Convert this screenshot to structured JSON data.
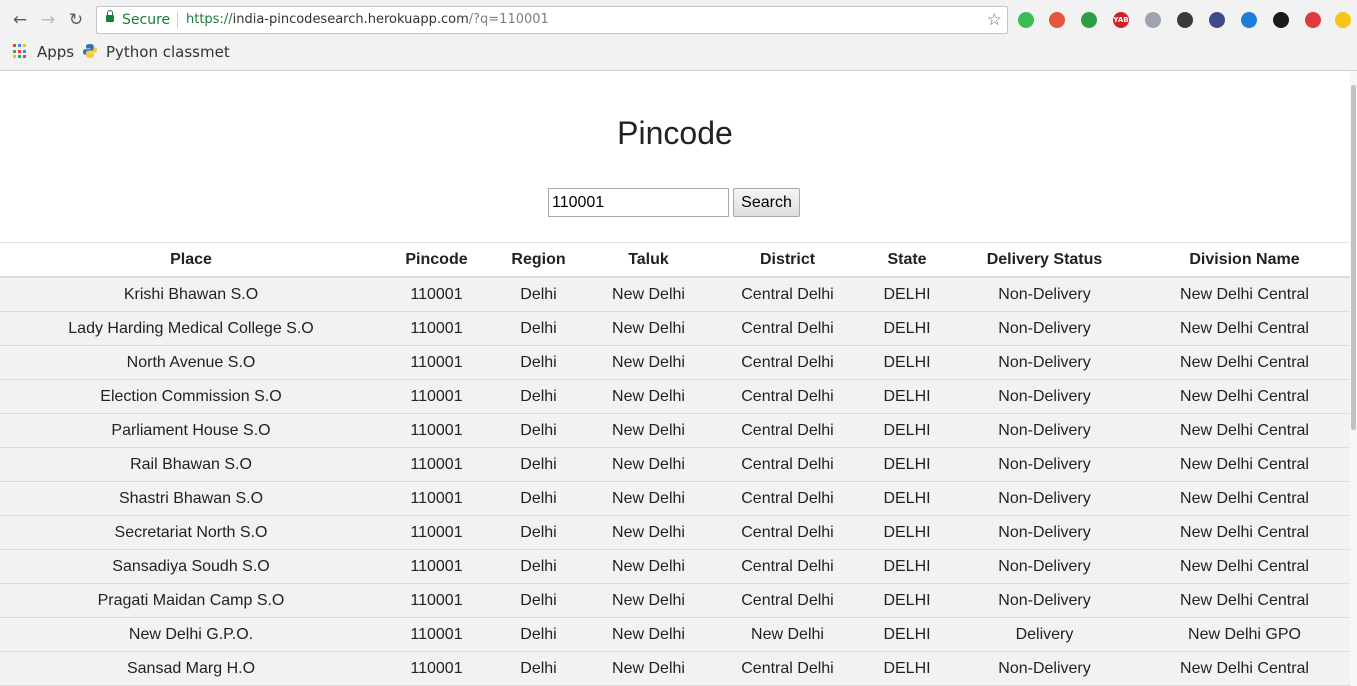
{
  "browser": {
    "secure_label": "Secure",
    "url_scheme": "https://",
    "url_host": "india-pincodesearch.herokuapp.com",
    "url_rest": "/?q=110001",
    "bookmarks": {
      "apps_label": "Apps",
      "python_label": "Python classmet"
    },
    "extensions": [
      {
        "name": "green-extension-icon",
        "color": "#3cba54"
      },
      {
        "name": "blocked-site-extension-icon",
        "color": "#e2553f"
      },
      {
        "name": "green-shield-extension-icon",
        "color": "#2e9e45"
      },
      {
        "name": "yab-extension-icon",
        "color": "#d62027",
        "label": "YAB"
      },
      {
        "name": "gray-circle-extension-icon",
        "color": "#9ea3b0"
      },
      {
        "name": "dark-square-extension-icon",
        "color": "#3a3a3a"
      },
      {
        "name": "at-sign-extension-icon",
        "color": "#3d4b8a"
      },
      {
        "name": "blue-badge-extension-icon",
        "color": "#1e7dd6"
      },
      {
        "name": "github-extension-icon",
        "color": "#1b1b1b"
      },
      {
        "name": "red-tag-extension-icon",
        "color": "#e23a3a"
      },
      {
        "name": "yellow-alert-extension-icon",
        "color": "#f5c518"
      }
    ]
  },
  "page": {
    "title": "Pincode",
    "search": {
      "value": "110001",
      "button_label": "Search"
    }
  },
  "table": {
    "headers": {
      "place": "Place",
      "pincode": "Pincode",
      "region": "Region",
      "taluk": "Taluk",
      "district": "District",
      "state": "State",
      "delivery_status": "Delivery Status",
      "division_name": "Division Name"
    },
    "rows": [
      {
        "place": "Krishi Bhawan S.O",
        "pincode": "110001",
        "region": "Delhi",
        "taluk": "New Delhi",
        "district": "Central Delhi",
        "state": "DELHI",
        "delivery_status": "Non-Delivery",
        "division_name": "New Delhi Central"
      },
      {
        "place": "Lady Harding Medical College S.O",
        "pincode": "110001",
        "region": "Delhi",
        "taluk": "New Delhi",
        "district": "Central Delhi",
        "state": "DELHI",
        "delivery_status": "Non-Delivery",
        "division_name": "New Delhi Central"
      },
      {
        "place": "North Avenue S.O",
        "pincode": "110001",
        "region": "Delhi",
        "taluk": "New Delhi",
        "district": "Central Delhi",
        "state": "DELHI",
        "delivery_status": "Non-Delivery",
        "division_name": "New Delhi Central"
      },
      {
        "place": "Election Commission S.O",
        "pincode": "110001",
        "region": "Delhi",
        "taluk": "New Delhi",
        "district": "Central Delhi",
        "state": "DELHI",
        "delivery_status": "Non-Delivery",
        "division_name": "New Delhi Central"
      },
      {
        "place": "Parliament House S.O",
        "pincode": "110001",
        "region": "Delhi",
        "taluk": "New Delhi",
        "district": "Central Delhi",
        "state": "DELHI",
        "delivery_status": "Non-Delivery",
        "division_name": "New Delhi Central"
      },
      {
        "place": "Rail Bhawan S.O",
        "pincode": "110001",
        "region": "Delhi",
        "taluk": "New Delhi",
        "district": "Central Delhi",
        "state": "DELHI",
        "delivery_status": "Non-Delivery",
        "division_name": "New Delhi Central"
      },
      {
        "place": "Shastri Bhawan S.O",
        "pincode": "110001",
        "region": "Delhi",
        "taluk": "New Delhi",
        "district": "Central Delhi",
        "state": "DELHI",
        "delivery_status": "Non-Delivery",
        "division_name": "New Delhi Central"
      },
      {
        "place": "Secretariat North S.O",
        "pincode": "110001",
        "region": "Delhi",
        "taluk": "New Delhi",
        "district": "Central Delhi",
        "state": "DELHI",
        "delivery_status": "Non-Delivery",
        "division_name": "New Delhi Central"
      },
      {
        "place": "Sansadiya Soudh S.O",
        "pincode": "110001",
        "region": "Delhi",
        "taluk": "New Delhi",
        "district": "Central Delhi",
        "state": "DELHI",
        "delivery_status": "Non-Delivery",
        "division_name": "New Delhi Central"
      },
      {
        "place": "Pragati Maidan Camp S.O",
        "pincode": "110001",
        "region": "Delhi",
        "taluk": "New Delhi",
        "district": "Central Delhi",
        "state": "DELHI",
        "delivery_status": "Non-Delivery",
        "division_name": "New Delhi Central"
      },
      {
        "place": "New Delhi G.P.O.",
        "pincode": "110001",
        "region": "Delhi",
        "taluk": "New Delhi",
        "district": "New Delhi",
        "state": "DELHI",
        "delivery_status": "Delivery",
        "division_name": "New Delhi GPO"
      },
      {
        "place": "Sansad Marg H.O",
        "pincode": "110001",
        "region": "Delhi",
        "taluk": "New Delhi",
        "district": "Central Delhi",
        "state": "DELHI",
        "delivery_status": "Non-Delivery",
        "division_name": "New Delhi Central"
      }
    ]
  }
}
